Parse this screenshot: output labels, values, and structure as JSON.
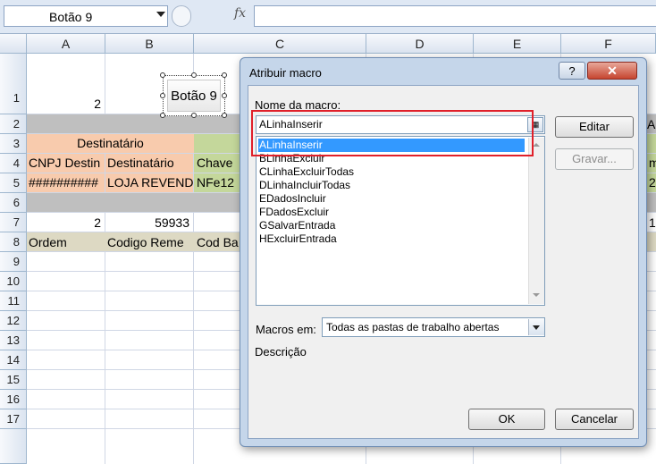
{
  "formula_bar": {
    "name_box": "Botão 9",
    "fx": "fx",
    "formula": ""
  },
  "sheet": {
    "columns": [
      "A",
      "B",
      "C",
      "D",
      "E",
      "F"
    ],
    "rows": [
      "1",
      "2",
      "3",
      "4",
      "5",
      "6",
      "7",
      "8",
      "9",
      "10",
      "11",
      "12",
      "13",
      "14",
      "15",
      "16",
      "17"
    ],
    "cells": {
      "A1": "2",
      "A3_B3": "Destinatário",
      "A4": "CNPJ Destin",
      "B4": "Destinatário",
      "C4": "Chave",
      "A5": "##########",
      "B5": "LOJA REVEND",
      "C5": "NFe12",
      "A7": "2",
      "B7": "59933",
      "A8": "Ordem",
      "B8": "Codigo Reme",
      "C8": "Cod Ba",
      "F2_edge": "A",
      "F4_edge": "m",
      "F5_edge": "2",
      "F7_edge": "1"
    },
    "shape_button_label": "Botão 9",
    "colors": {
      "destinatario_band": "#f8cbad",
      "header_row": "#ddd9c3",
      "chave_band": "#c4d79b",
      "gray_row": "#bfbfbf"
    }
  },
  "dialog": {
    "title": "Atribuir macro",
    "help_label": "?",
    "close_label": "✕",
    "macro_name_label": "Nome da macro:",
    "macro_name_value": "ALinhaInserir",
    "macro_list": [
      "ALinhaInserir",
      "BLinhaExcluir",
      "CLinhaExcluirTodas",
      "DLinhaIncluirTodas",
      "EDadosIncluir",
      "FDadosExcluir",
      "GSalvarEntrada",
      "HExcluirEntrada"
    ],
    "selected_macro": "ALinhaInserir",
    "edit_button": "Editar",
    "record_button": "Gravar...",
    "macros_in_label": "Macros em:",
    "macros_in_value": "Todas as pastas de trabalho abertas",
    "description_label": "Descrição",
    "ok_button": "OK",
    "cancel_button": "Cancelar"
  }
}
